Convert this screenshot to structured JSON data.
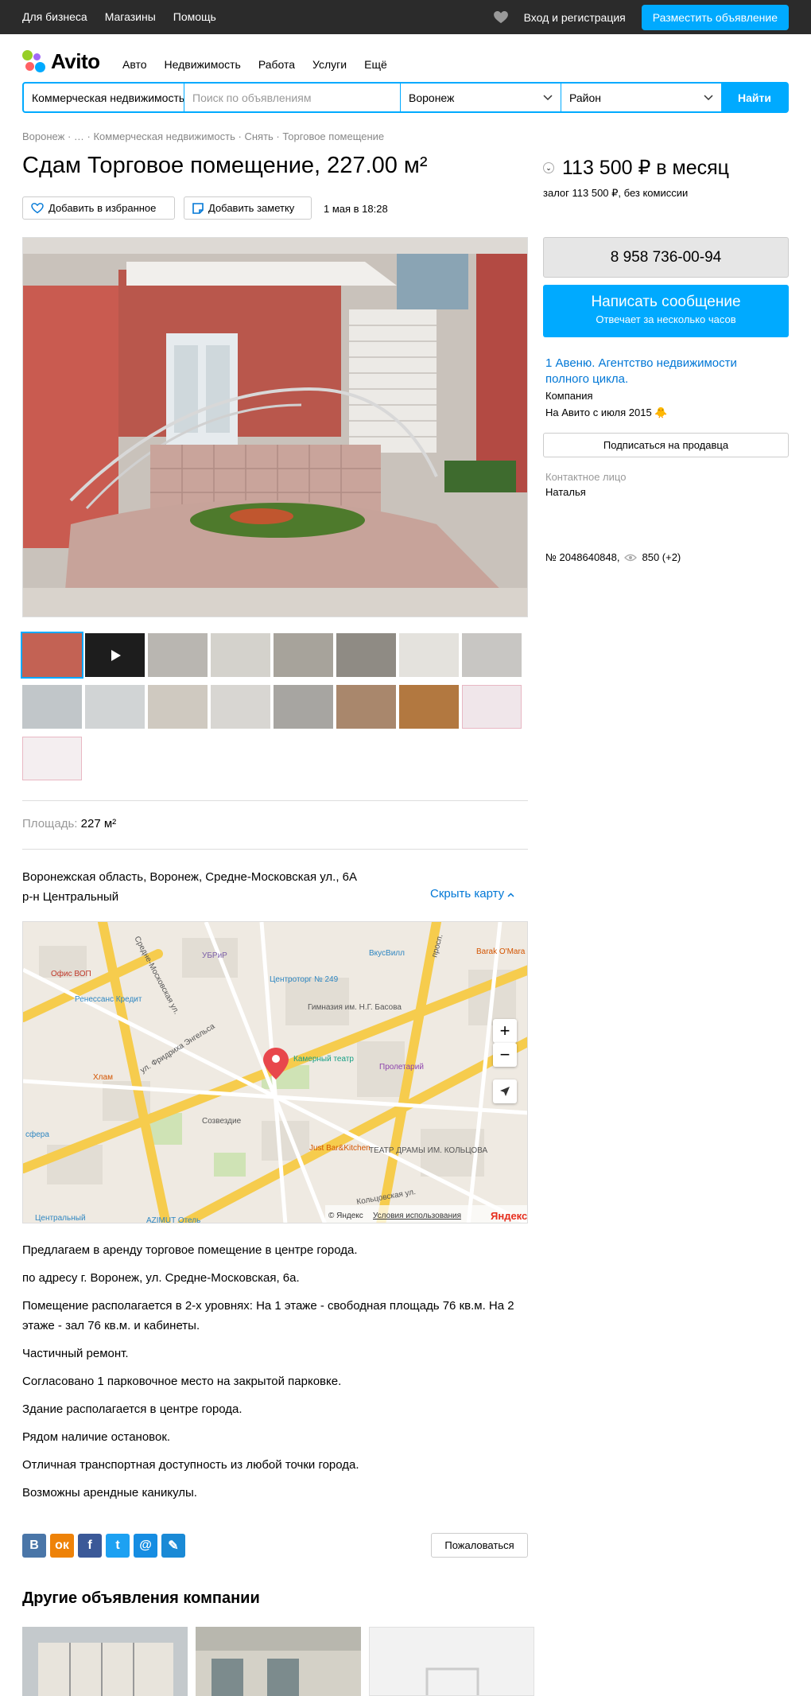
{
  "topbar": {
    "links": [
      "Для бизнеса",
      "Магазины",
      "Помощь"
    ],
    "login": "Вход и регистрация",
    "post_button": "Разместить объявление"
  },
  "logo": {
    "text": "Avito"
  },
  "nav": [
    "Авто",
    "Недвижимость",
    "Работа",
    "Услуги",
    "Ещё"
  ],
  "search": {
    "category": "Коммерческая недвижимость",
    "placeholder": "Поиск по объявлениям",
    "city": "Воронеж",
    "district": "Район",
    "button": "Найти"
  },
  "breadcrumb": [
    "Воронеж",
    "…",
    "Коммерческая недвижимость",
    "Снять",
    "Торговое помещение"
  ],
  "listing": {
    "title": "Сдам Торговое помещение, 227.00 м²",
    "price": "113 500 ₽ в месяц",
    "currency_icon": "₽",
    "deposit": "залог 113 500 ₽, без комиссии",
    "favorite_label": "Добавить в избранное",
    "note_label": "Добавить заметку",
    "date": "1 мая в 18:28",
    "area_label": "Площадь:",
    "area_value": "227 м²",
    "address": "Воронежская область, Воронеж, Средне-Московская ул., 6А",
    "district": "р-н Центральный",
    "hide_map": "Скрыть карту",
    "description": [
      "Предлагаем в аренду торговое помещение в центре города.",
      "по адресу г. Воронеж, ул. Средне-Московская, 6а.",
      "Помещение располагается в 2-х уровнях: На 1 этаже - свободная площадь 76 кв.м. На 2 этаже - зал 76 кв.м. и кабинеты.",
      "Частичный ремонт.",
      "Согласовано 1 парковочное место на закрытой парковке.",
      "Здание располагается в центре города.",
      "Рядом наличие остановок.",
      "Отличная транспортная доступность из любой точки города.",
      "Возможны арендные каникулы."
    ],
    "complain": "Пожаловаться"
  },
  "share": [
    {
      "label": "В",
      "color": "#4a76a8"
    },
    {
      "label": "ок",
      "color": "#ee8208"
    },
    {
      "label": "f",
      "color": "#3b5998"
    },
    {
      "label": "t",
      "color": "#1da1f2"
    },
    {
      "label": "@",
      "color": "#168de2"
    },
    {
      "label": "✎",
      "color": "#1a8ad6"
    }
  ],
  "sidebar": {
    "phone": "8 958 736-00-94",
    "message_title": "Написать сообщение",
    "message_sub": "Отвечает за несколько часов",
    "seller_name": "1 Авеню. Агентство недвижимости полного цикла.",
    "seller_type": "Компания",
    "on_avito": "На Авито с июля 2015",
    "subscribe": "Подписаться на продавца",
    "contact_label": "Контактное лицо",
    "contact_name": "Наталья",
    "ad_number": "№ 2048640848,",
    "views": "850 (+2)"
  },
  "map": {
    "labels": [
      "Офис ВОП",
      "УБРиР",
      "Ренессанс Кредит",
      "Хлам",
      "Центроторг № 249",
      "ВкусВилл",
      "Гимназия им. Н.Г. Басова",
      "Камерный театр",
      "Пролетарий",
      "Созвездие",
      "Just Bar&Kitchen",
      "ТЕАТР ДРАМЫ ИМ. КОЛЬЦОВА",
      "Barak O'Mara",
      "ул. Фридриха Энгельса",
      "Средне-Московская ул.",
      "просп.",
      "Кольцовская ул.",
      "Центральный",
      "сфера",
      "AZIMUT Отель"
    ],
    "copyright": "© Яндекс",
    "terms": "Условия использования",
    "brand": "Яндекс"
  },
  "other_ads_title": "Другие объявления компании",
  "colors": {
    "accent": "#00aaff",
    "link": "#0077d6",
    "topbar": "#2b2b2b",
    "pin": "#e8474c"
  }
}
